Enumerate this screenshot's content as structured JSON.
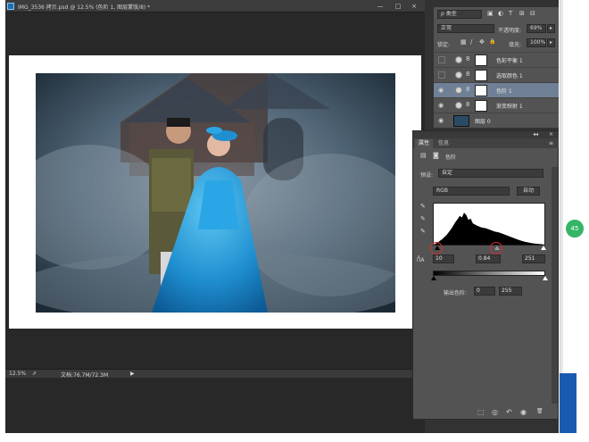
{
  "document": {
    "title": "IMG_3536 拷贝.psd @ 12.5% (色阶 1, 图层蒙版/8) *",
    "minimize": "—",
    "restore": "□",
    "close": "×",
    "zoom": "12.5%",
    "doc_size": "文档:76.7M/72.3M",
    "arrow": "▶"
  },
  "layers_panel": {
    "filter_kind": "ρ 类型",
    "filter_icons": [
      "▣",
      "◐",
      "T",
      "⊞",
      "⊟"
    ],
    "blend_mode": "正常",
    "opacity_label": "不透明度:",
    "opacity_value": "69%",
    "lock_label": "锁定:",
    "lock_icons": [
      "▦",
      "/",
      "✥",
      "🔒"
    ],
    "fill_label": "填充:",
    "fill_value": "100%",
    "layers": [
      {
        "name": "色彩平衡 1",
        "visible": false,
        "selected": false
      },
      {
        "name": "选取颜色 1",
        "visible": false,
        "selected": false
      },
      {
        "name": "色阶 1",
        "visible": true,
        "selected": true
      },
      {
        "name": "渐变映射 1",
        "visible": true,
        "selected": false
      },
      {
        "name": "图层 0",
        "visible": true,
        "selected": false
      }
    ]
  },
  "properties_panel": {
    "collapse": "◂◂",
    "close_x": "×",
    "tab_properties": "属性",
    "tab_info": "信息",
    "menu": "≡",
    "head_icons": [
      "▤",
      "◙"
    ],
    "head_title": "色阶",
    "preset_label": "预设:",
    "preset_value": "自定",
    "channel_value": "RGB",
    "auto_button": "自动",
    "eyedropper_icons": [
      "✎",
      "✎",
      "✎"
    ],
    "input_black": "10",
    "input_gamma": "0.84",
    "input_white": "251",
    "output_label": "输出色阶:",
    "output_black": "0",
    "output_white": "255",
    "bottom_icons": [
      "⬚",
      "◎",
      "↶",
      "◉",
      "🗑"
    ],
    "channel_icon": "ᑍA"
  },
  "badge": {
    "text": "45"
  },
  "chart_data": {
    "type": "area",
    "title": "",
    "xlabel": "",
    "ylabel": "",
    "xlim": [
      0,
      255
    ],
    "ylim": [
      0,
      100
    ],
    "x": [
      0,
      10,
      20,
      30,
      40,
      50,
      55,
      60,
      65,
      70,
      75,
      80,
      85,
      90,
      100,
      110,
      120,
      130,
      140,
      150,
      160,
      170,
      180,
      190,
      200,
      210,
      220,
      230,
      240,
      250,
      255
    ],
    "values": [
      0,
      6,
      14,
      24,
      38,
      55,
      62,
      70,
      66,
      78,
      72,
      60,
      64,
      52,
      46,
      42,
      40,
      36,
      32,
      30,
      26,
      22,
      18,
      14,
      10,
      7,
      5,
      3,
      2,
      1,
      0
    ],
    "color": "#ffffff",
    "fill": "#000000"
  },
  "colors": {
    "ps_dark": "#282828",
    "panel": "#535353",
    "selected": "#6f7f95",
    "accent_blue": "#1a5bb0",
    "badge_green": "#35b565"
  }
}
